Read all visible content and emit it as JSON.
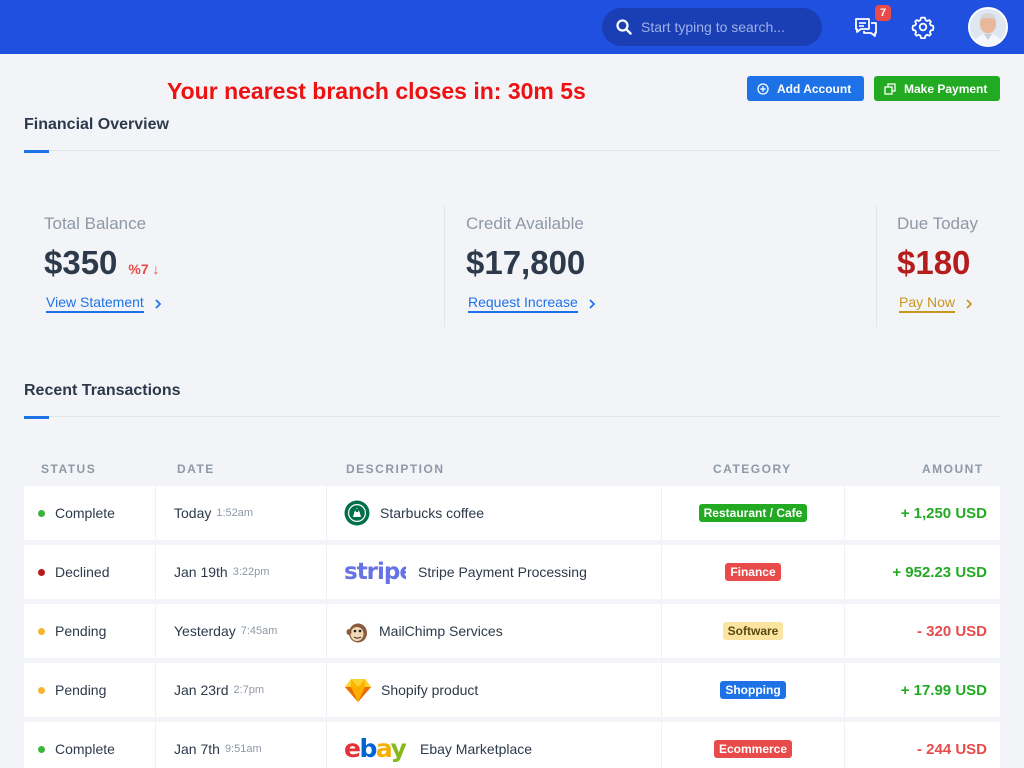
{
  "topbar": {
    "search_placeholder": "Start typing to search...",
    "notification_count": "7"
  },
  "header": {
    "countdown": "Your nearest branch closes in: 30m 5s",
    "add_account_label": "Add Account",
    "make_payment_label": "Make Payment"
  },
  "overview": {
    "title": "Financial Overview",
    "stats": [
      {
        "label": "Total Balance",
        "value": "$350",
        "change": "%7 ↓",
        "link": "View Statement",
        "value_color": "#2d3a4b",
        "link_color": "#1e72e8"
      },
      {
        "label": "Credit Available",
        "value": "$17,800",
        "change": "",
        "link": "Request Increase",
        "value_color": "#2d3a4b",
        "link_color": "#1e72e8"
      },
      {
        "label": "Due Today",
        "value": "$180",
        "change": "",
        "link": "Pay Now",
        "value_color": "#b61c1c",
        "link_color": "#c8961e"
      }
    ]
  },
  "transactions": {
    "title": "Recent Transactions",
    "columns": [
      "STATUS",
      "DATE",
      "DESCRIPTION",
      "CATEGORY",
      "AMOUNT"
    ],
    "rows": [
      {
        "status": "Complete",
        "status_color": "#3cb43c",
        "date": "Today",
        "time": "1:52am",
        "logo": "starbucks-logo",
        "description": "Starbucks coffee",
        "category": "Restaurant / Cafe",
        "category_bg": "#22aa22",
        "category_fg": "#ffffff",
        "amount": "+ 1,250 USD",
        "amount_color": "#22aa22"
      },
      {
        "status": "Declined",
        "status_color": "#b61c1c",
        "date": "Jan 19th",
        "time": "3:22pm",
        "logo": "stripe-logo",
        "description": "Stripe Payment Processing",
        "category": "Finance",
        "category_bg": "#e94a4a",
        "category_fg": "#ffffff",
        "amount": "+ 952.23 USD",
        "amount_color": "#22aa22"
      },
      {
        "status": "Pending",
        "status_color": "#f2b630",
        "date": "Yesterday",
        "time": "7:45am",
        "logo": "mailchimp-logo",
        "description": "MailChimp Services",
        "category": "Software",
        "category_bg": "#fbe4a0",
        "category_fg": "#5a4a10",
        "amount": "- 320 USD",
        "amount_color": "#e94a4a"
      },
      {
        "status": "Pending",
        "status_color": "#f2b630",
        "date": "Jan 23rd",
        "time": "2:7pm",
        "logo": "sketch-logo",
        "description": "Shopify product",
        "category": "Shopping",
        "category_bg": "#1e72e8",
        "category_fg": "#ffffff",
        "amount": "+ 17.99 USD",
        "amount_color": "#22aa22"
      },
      {
        "status": "Complete",
        "status_color": "#3cb43c",
        "date": "Jan 7th",
        "time": "9:51am",
        "logo": "ebay-logo",
        "description": "Ebay Marketplace",
        "category": "Ecommerce",
        "category_bg": "#e94a4a",
        "category_fg": "#ffffff",
        "amount": "- 244 USD",
        "amount_color": "#e94a4a"
      }
    ]
  }
}
